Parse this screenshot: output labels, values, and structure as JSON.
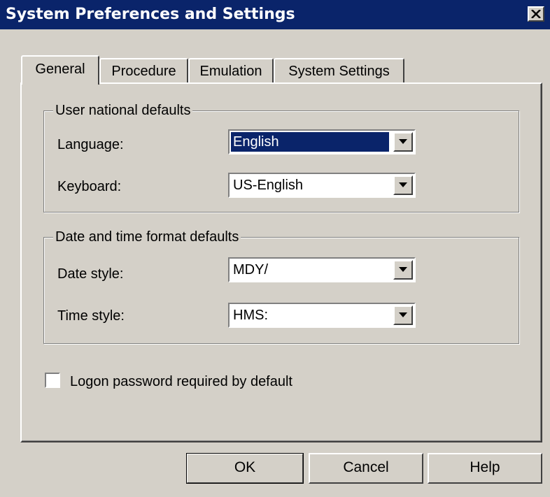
{
  "window": {
    "title": "System Preferences and Settings"
  },
  "tabs": [
    {
      "label": "General"
    },
    {
      "label": "Procedure"
    },
    {
      "label": "Emulation"
    },
    {
      "label": "System Settings"
    }
  ],
  "user_national_defaults": {
    "legend": "User national defaults",
    "language_label": "Language:",
    "language_value": "English",
    "keyboard_label": "Keyboard:",
    "keyboard_value": "US-English"
  },
  "date_time_defaults": {
    "legend": "Date and time format defaults",
    "date_style_label": "Date style:",
    "date_style_value": "MDY/",
    "time_style_label": "Time style:",
    "time_style_value": "HMS:"
  },
  "logon_password": {
    "label": "Logon password required by default",
    "checked": false
  },
  "buttons": {
    "ok": "OK",
    "cancel": "Cancel",
    "help": "Help"
  },
  "icons": {
    "close": "close-icon",
    "dropdown": "chevron-down-icon"
  },
  "colors": {
    "titlebar": "#0a246a",
    "selection": "#0a246a",
    "face": "#d4d0c8"
  }
}
